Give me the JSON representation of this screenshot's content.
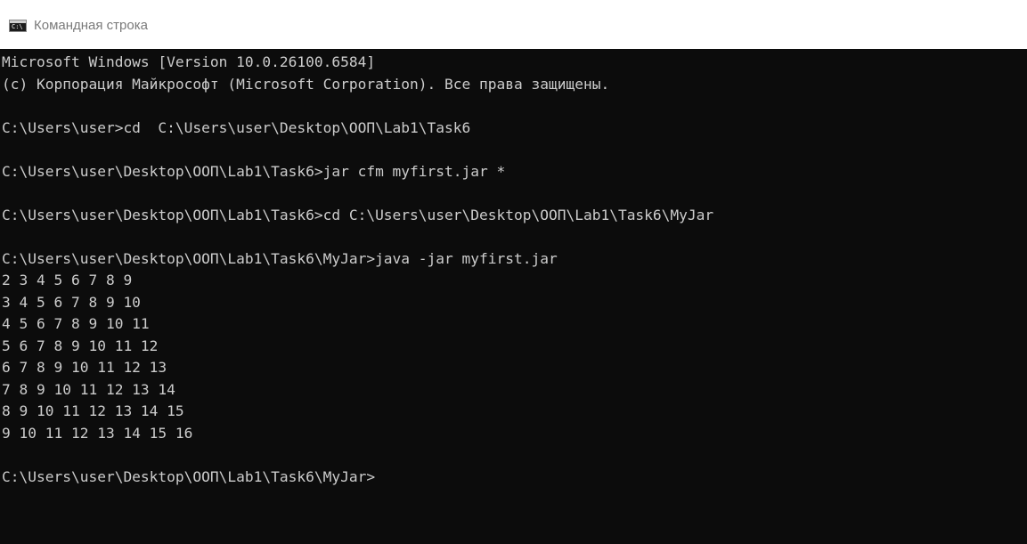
{
  "window": {
    "title": "Командная строка",
    "icon": "cmd-icon",
    "icon_glyph": "C:\\"
  },
  "console": {
    "lines": [
      "Microsoft Windows [Version 10.0.26100.6584]",
      "(c) Корпорация Майкрософт (Microsoft Corporation). Все права защищены.",
      "",
      "C:\\Users\\user>cd  C:\\Users\\user\\Desktop\\ООП\\Lab1\\Task6",
      "",
      "C:\\Users\\user\\Desktop\\ООП\\Lab1\\Task6>jar cfm myfirst.jar *",
      "",
      "C:\\Users\\user\\Desktop\\ООП\\Lab1\\Task6>cd C:\\Users\\user\\Desktop\\ООП\\Lab1\\Task6\\MyJar",
      "",
      "C:\\Users\\user\\Desktop\\ООП\\Lab1\\Task6\\MyJar>java -jar myfirst.jar",
      "2 3 4 5 6 7 8 9",
      "3 4 5 6 7 8 9 10",
      "4 5 6 7 8 9 10 11",
      "5 6 7 8 9 10 11 12",
      "6 7 8 9 10 11 12 13",
      "7 8 9 10 11 12 13 14",
      "8 9 10 11 12 13 14 15",
      "9 10 11 12 13 14 15 16",
      "",
      "C:\\Users\\user\\Desktop\\ООП\\Lab1\\Task6\\MyJar>"
    ]
  },
  "colors": {
    "titlebar_bg": "#ffffff",
    "title_text": "#7a7a7a",
    "console_bg": "#0c0c0c",
    "console_text": "#cccccc"
  }
}
